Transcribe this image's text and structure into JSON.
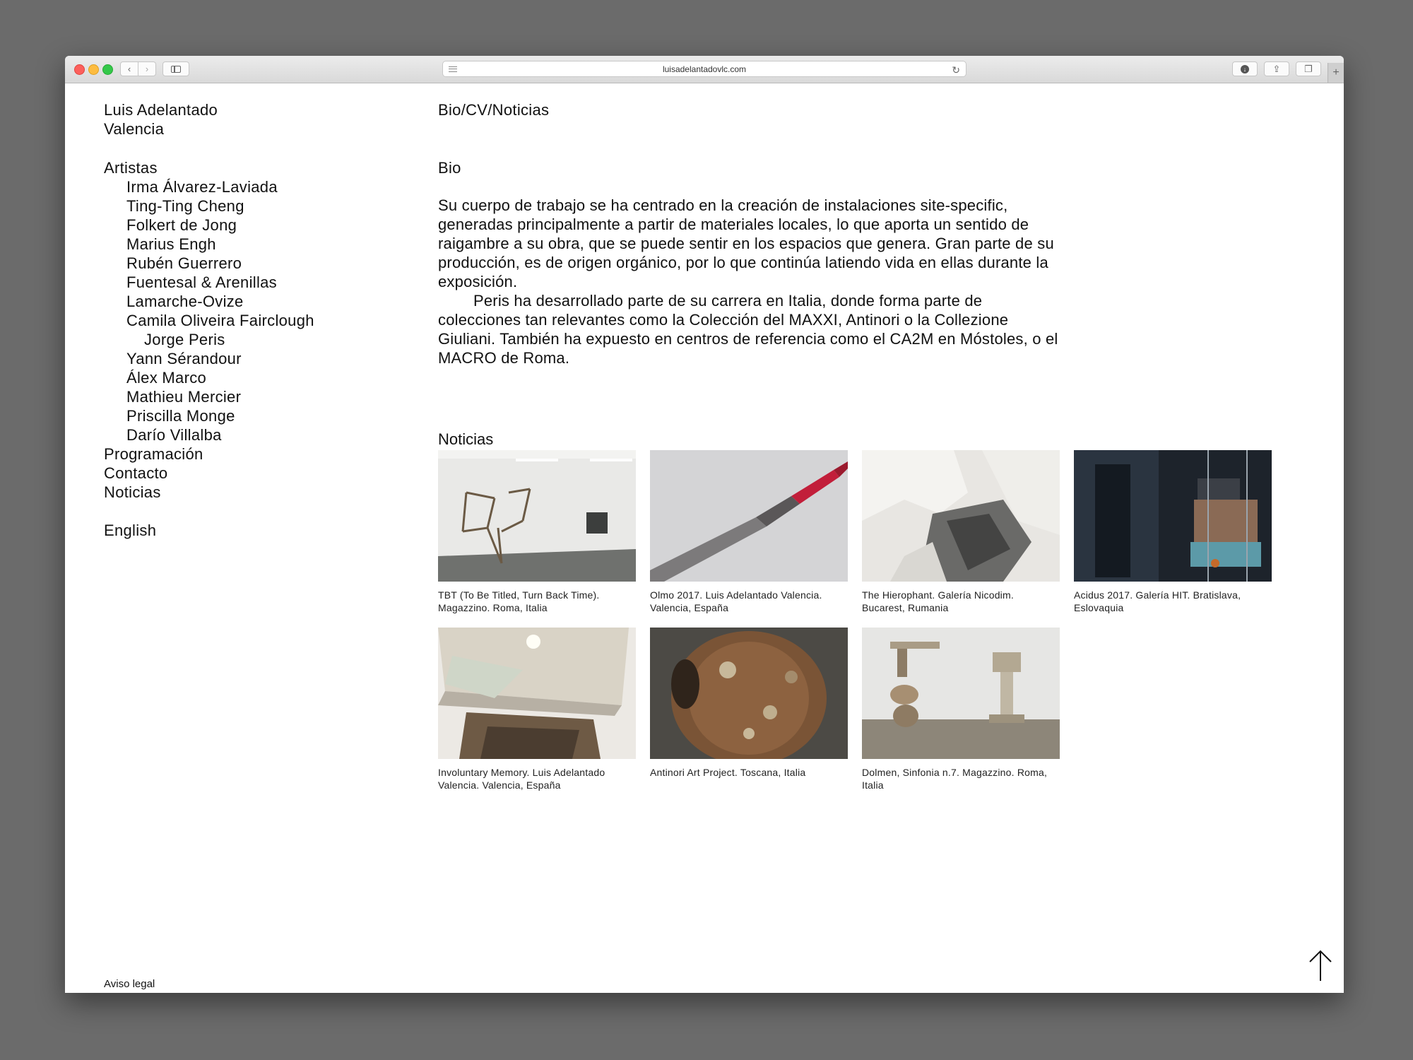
{
  "browser": {
    "url": "luisadelantadovlc.com"
  },
  "site": {
    "brand_line1": "Luis Adelantado",
    "brand_line2": "Valencia",
    "nav": {
      "artistas": "Artistas",
      "artists": [
        "Irma Álvarez-Laviada",
        "Ting-Ting Cheng",
        "Folkert de Jong",
        "Marius Engh",
        "Rubén Guerrero",
        "Fuentesal & Arenillas",
        "Lamarche-Ovize",
        "Camila Oliveira Fairclough",
        "Jorge Peris",
        "Yann Sérandour",
        "Álex Marco",
        "Mathieu Mercier",
        "Priscilla Monge",
        "Darío Villalba"
      ],
      "programacion": "Programación",
      "contacto": "Contacto",
      "noticias": "Noticias",
      "english": "English"
    },
    "footer": {
      "aviso": "Aviso legal"
    }
  },
  "main": {
    "page_title": "Bio/CV/Noticias",
    "bio_title": "Bio",
    "bio_p1": "Su cuerpo de trabajo se ha centrado en la creación de instalaciones site-specific, generadas principalmente a partir de materiales locales, lo que aporta un sentido de raigambre a su obra, que se puede sentir en los espacios que genera. Gran parte de su producción, es de origen orgánico, por lo que continúa latiendo vida en ellas durante la exposición.",
    "bio_p2": "Peris ha desarrollado parte de su carrera en Italia, donde forma parte de colecciones tan relevantes como la Colección del MAXXI, Antinori o la Collezione Giuliani. También ha expuesto en centros de referencia como el CA2M en Móstoles, o el MACRO de Roma.",
    "noticias_title": "Noticias",
    "news": [
      {
        "caption": "TBT (To Be Titled, Turn Back Time). Magazzino. Roma, Italia"
      },
      {
        "caption": "Olmo 2017. Luis Adelantado Valencia. Valencia, España"
      },
      {
        "caption": "The Hierophant. Galería Nicodim. Bucarest, Rumania"
      },
      {
        "caption": "Acidus 2017. Galería HIT. Bratislava, Eslovaquia"
      },
      {
        "caption": "Involuntary Memory. Luis Adelantado Valencia. Valencia, España"
      },
      {
        "caption": "Antinori Art Project. Toscana, Italia"
      },
      {
        "caption": "Dolmen, Sinfonia n.7. Magazzino. Roma, Italia"
      }
    ]
  }
}
